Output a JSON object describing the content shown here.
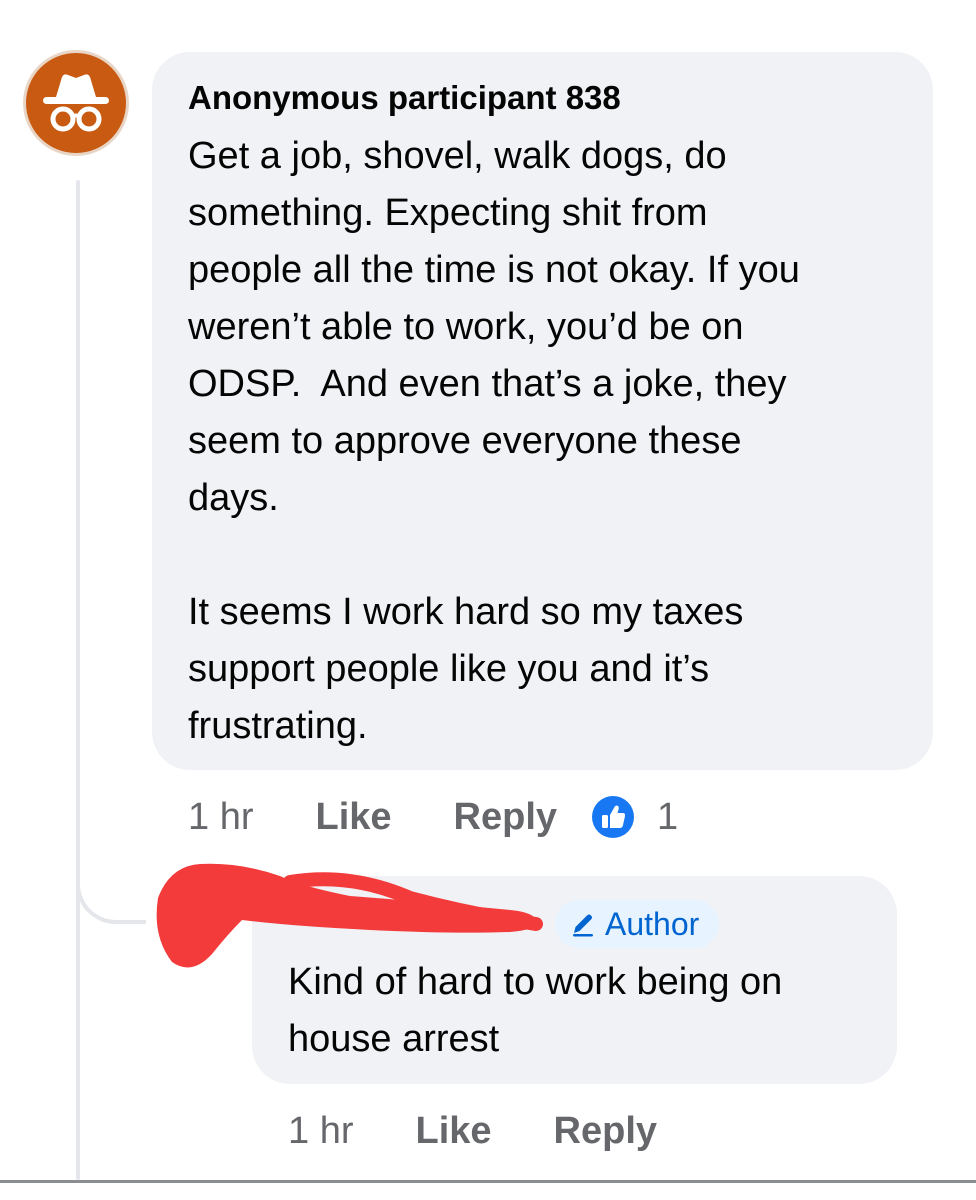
{
  "comments": [
    {
      "author": "Anonymous participant 838",
      "avatar_icon": "incognito-icon",
      "text": "Get a job, shovel, walk dogs, do\nsomething. Expecting shit from\npeople all the time is not okay. If you\nweren’t able to work, you’d be on\nODSP.  And even that’s a joke, they\nseem to approve everyone these\ndays.\n\nIt seems I work hard so my taxes\nsupport people like you and it’s\nfrustrating.",
      "time": "1 hr",
      "like_label": "Like",
      "reply_label": "Reply",
      "reaction_icon": "thumbs-up-icon",
      "reaction_count": "1"
    },
    {
      "badge_label": "Author",
      "badge_icon": "pencil-icon",
      "text": "Kind of hard to work being on\nhouse arrest",
      "time": "1 hr",
      "like_label": "Like",
      "reply_label": "Reply"
    }
  ],
  "colors": {
    "bubble": "#f0f2f5",
    "meta_text": "#65676b",
    "like_blue": "#1877f2",
    "avatar": "#c85a12",
    "redaction": "#f43b3b",
    "badge_bg": "#e7f3ff"
  }
}
